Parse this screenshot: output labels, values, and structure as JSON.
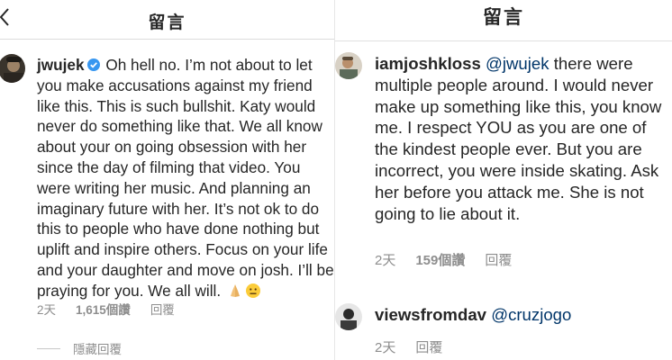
{
  "left": {
    "header_title": "留言",
    "comment": {
      "username": "jwujek",
      "text": " Oh hell no. I’m not about to let you make accusations against my friend like this. This is such bullshit. Katy would never do something like that.  We all know about your on going obsession with her since the day of filming that video.  You were writing her music. And planning an imaginary future with her. It’s not ok to do this to people who have done nothing but uplift and inspire others. Focus on your life and your daughter and move on josh. I’ll be praying for you. We all will. ",
      "time": "2天",
      "likes": "1,615個讚",
      "reply": "回覆"
    },
    "hide_replies": "隱藏回覆"
  },
  "right": {
    "header_title": "留言",
    "comment": {
      "username": "iamjoshkloss",
      "mention": "@jwujek",
      "text": "  there were multiple people around. I would never make up something like this, you know me. I respect YOU as you are one of the kindest people ever. But you are incorrect, you were inside skating. Ask her before you attack me. She is not going to lie about it.",
      "time": "2天",
      "likes": "159個讚",
      "reply": "回覆"
    },
    "comment2": {
      "username": "viewsfromdav",
      "mention": "@cruzjogo",
      "time": "2天",
      "reply": "回覆"
    }
  },
  "colors": {
    "text": "#262626",
    "meta": "#8e8e8e",
    "mention": "#003569",
    "verified": "#3897f0"
  }
}
